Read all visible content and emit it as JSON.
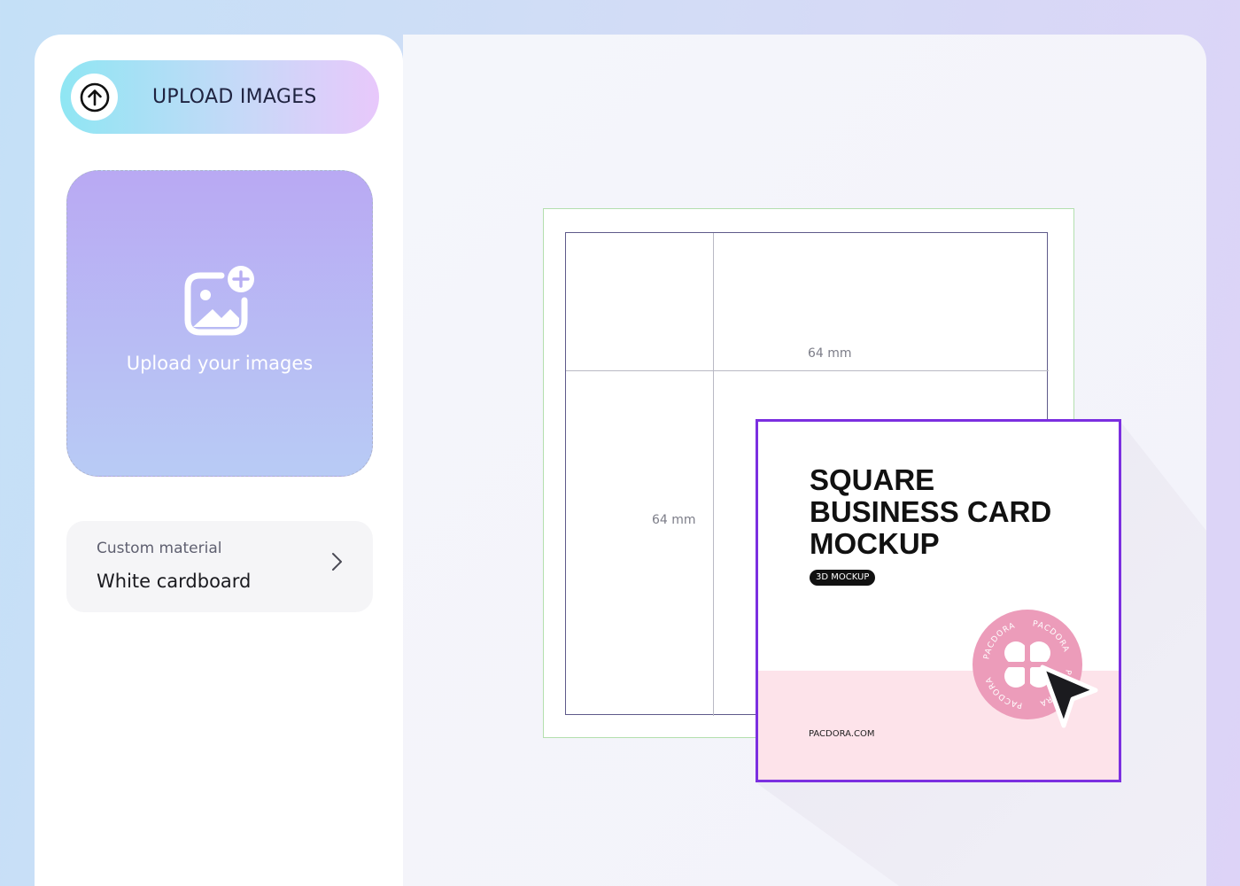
{
  "sidebar": {
    "upload_button": {
      "label": "UPLOAD IMAGES",
      "icon": "arrow-up-circle-icon"
    },
    "dropzone": {
      "text": "Upload your images",
      "icon": "image-add-icon"
    },
    "material": {
      "label": "Custom material",
      "value": "White cardboard",
      "icon": "chevron-right-icon"
    }
  },
  "canvas": {
    "dieline": {
      "width_label": "64 mm",
      "height_label": "64 mm"
    },
    "preview_card": {
      "title_lines": [
        "SQUARE",
        "BUSINESS CARD",
        "MOCKUP"
      ],
      "tag": "3D MOCKUP",
      "url": "PACDORA.COM",
      "stamp_text": "PACDORA",
      "colors": {
        "border": "#7b2fe0",
        "pink": "#fde3ea",
        "stamp": "#ec9cba"
      }
    },
    "cursor": {
      "icon": "mouse-pointer-icon"
    }
  },
  "colors": {
    "accent_gradient_start": "#8fe6f3",
    "accent_gradient_end": "#e8c8fb",
    "dropzone_top": "#b9a9f3",
    "dropzone_bottom": "#b8cbf5"
  }
}
